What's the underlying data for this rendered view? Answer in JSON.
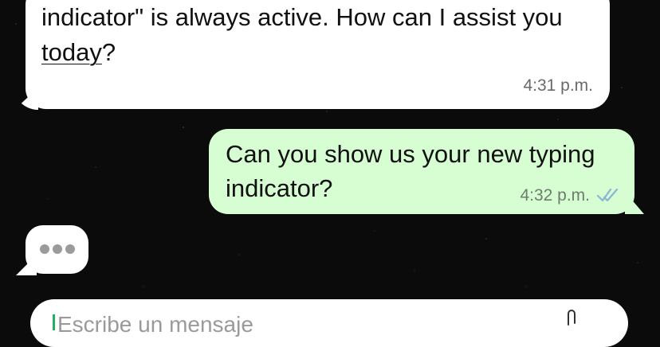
{
  "messages": {
    "incoming": {
      "text_line_1": "indicator\" is always active. How can I assist you",
      "text_word": "today",
      "text_end": "?",
      "time": "4:31 p.m."
    },
    "outgoing": {
      "text_line_1": "Can you show us your new typing",
      "text_line_2": "indicator?",
      "time": "4:32 p.m.",
      "status_icon": "double-check-icon"
    },
    "typing_indicator": {
      "icon": "typing-dots-icon"
    }
  },
  "composer": {
    "placeholder": "Escribe un mensaje",
    "attach_icon": "paperclip-icon"
  },
  "colors": {
    "incoming_bg": "#ffffff",
    "outgoing_bg": "#d7fdd3",
    "background": "#0b0b0c",
    "read_check": "#8ab6d6"
  }
}
